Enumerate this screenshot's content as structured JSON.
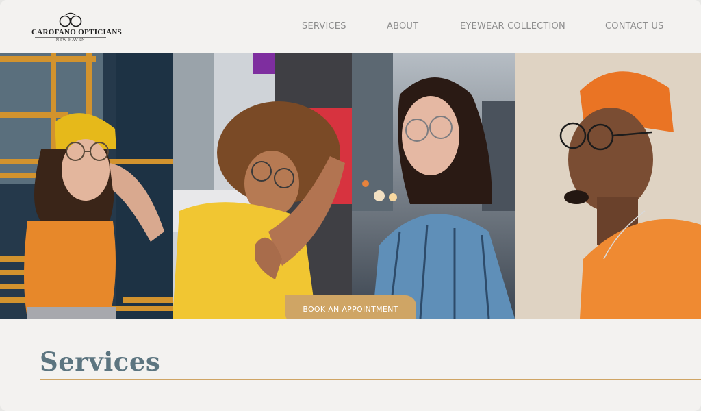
{
  "brand": {
    "name": "CAROFANO OPTICIANS",
    "location": "NEW HAVEN"
  },
  "nav": {
    "items": [
      {
        "label": "SERVICES"
      },
      {
        "label": "ABOUT"
      },
      {
        "label": "EYEWEAR COLLECTION"
      },
      {
        "label": "CONTACT US"
      }
    ]
  },
  "hero": {
    "cta_label": "BOOK AN APPOINTMENT",
    "panels": [
      {
        "icon": "woman-yellow-beanie-glasses-photo"
      },
      {
        "icon": "woman-curly-hair-yellow-tee-photo"
      },
      {
        "icon": "woman-bob-striped-shirt-photo"
      },
      {
        "icon": "man-orange-beanie-glasses-photo"
      }
    ]
  },
  "services": {
    "title": "Services"
  },
  "colors": {
    "accent": "#cfa565",
    "heading": "#5c7580",
    "nav_text": "#8d8d8d",
    "background": "#f3f2f0"
  }
}
